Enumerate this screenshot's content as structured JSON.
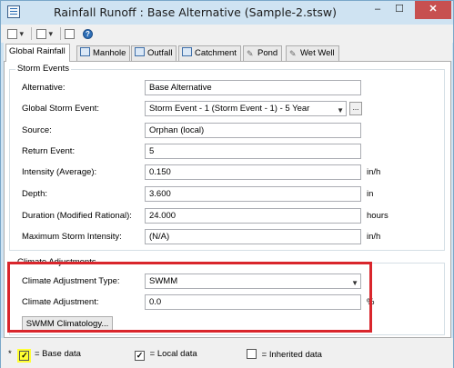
{
  "window": {
    "title": "Rainfall Runoff : Base Alternative (Sample-2.stsw)",
    "minimize": "–",
    "maximize": "☐",
    "close": "✕"
  },
  "toolbar": {
    "items": [
      "▾",
      "▾",
      "?"
    ]
  },
  "tabs": [
    {
      "label": "Global Rainfall"
    },
    {
      "label": "Manhole"
    },
    {
      "label": "Outfall"
    },
    {
      "label": "Catchment"
    },
    {
      "label": "Pond"
    },
    {
      "label": "Wet Well"
    }
  ],
  "storm_events": {
    "legend": "Storm Events",
    "alternative": {
      "label": "Alternative:",
      "value": "Base Alternative"
    },
    "global_storm_event": {
      "label": "Global Storm Event:",
      "value": "Storm Event - 1 (Storm Event - 1) - 5 Year",
      "button": "..."
    },
    "source": {
      "label": "Source:",
      "value": "Orphan (local)"
    },
    "return_event": {
      "label": "Return Event:",
      "value": "5"
    },
    "intensity": {
      "label": "Intensity (Average):",
      "value": "0.150",
      "unit": "in/h"
    },
    "depth": {
      "label": "Depth:",
      "value": "3.600",
      "unit": "in"
    },
    "duration": {
      "label": "Duration (Modified Rational):",
      "value": "24.000",
      "unit": "hours"
    },
    "max_intensity": {
      "label": "Maximum Storm Intensity:",
      "value": "(N/A)",
      "unit": "in/h"
    }
  },
  "climate": {
    "legend": "Climate Adjustments",
    "type": {
      "label": "Climate Adjustment Type:",
      "value": "SWMM"
    },
    "adjustment": {
      "label": "Climate Adjustment:",
      "value": "0.0",
      "unit": "%"
    },
    "climatology_button": "SWMM Climatology..."
  },
  "status": {
    "asterisk": "*",
    "base": "= Base data",
    "local": "= Local data",
    "inherited": "= Inherited data",
    "check": "✓"
  },
  "colors": {
    "highlight_box": "#d9262c",
    "base_checkbox": "#ffff33"
  }
}
